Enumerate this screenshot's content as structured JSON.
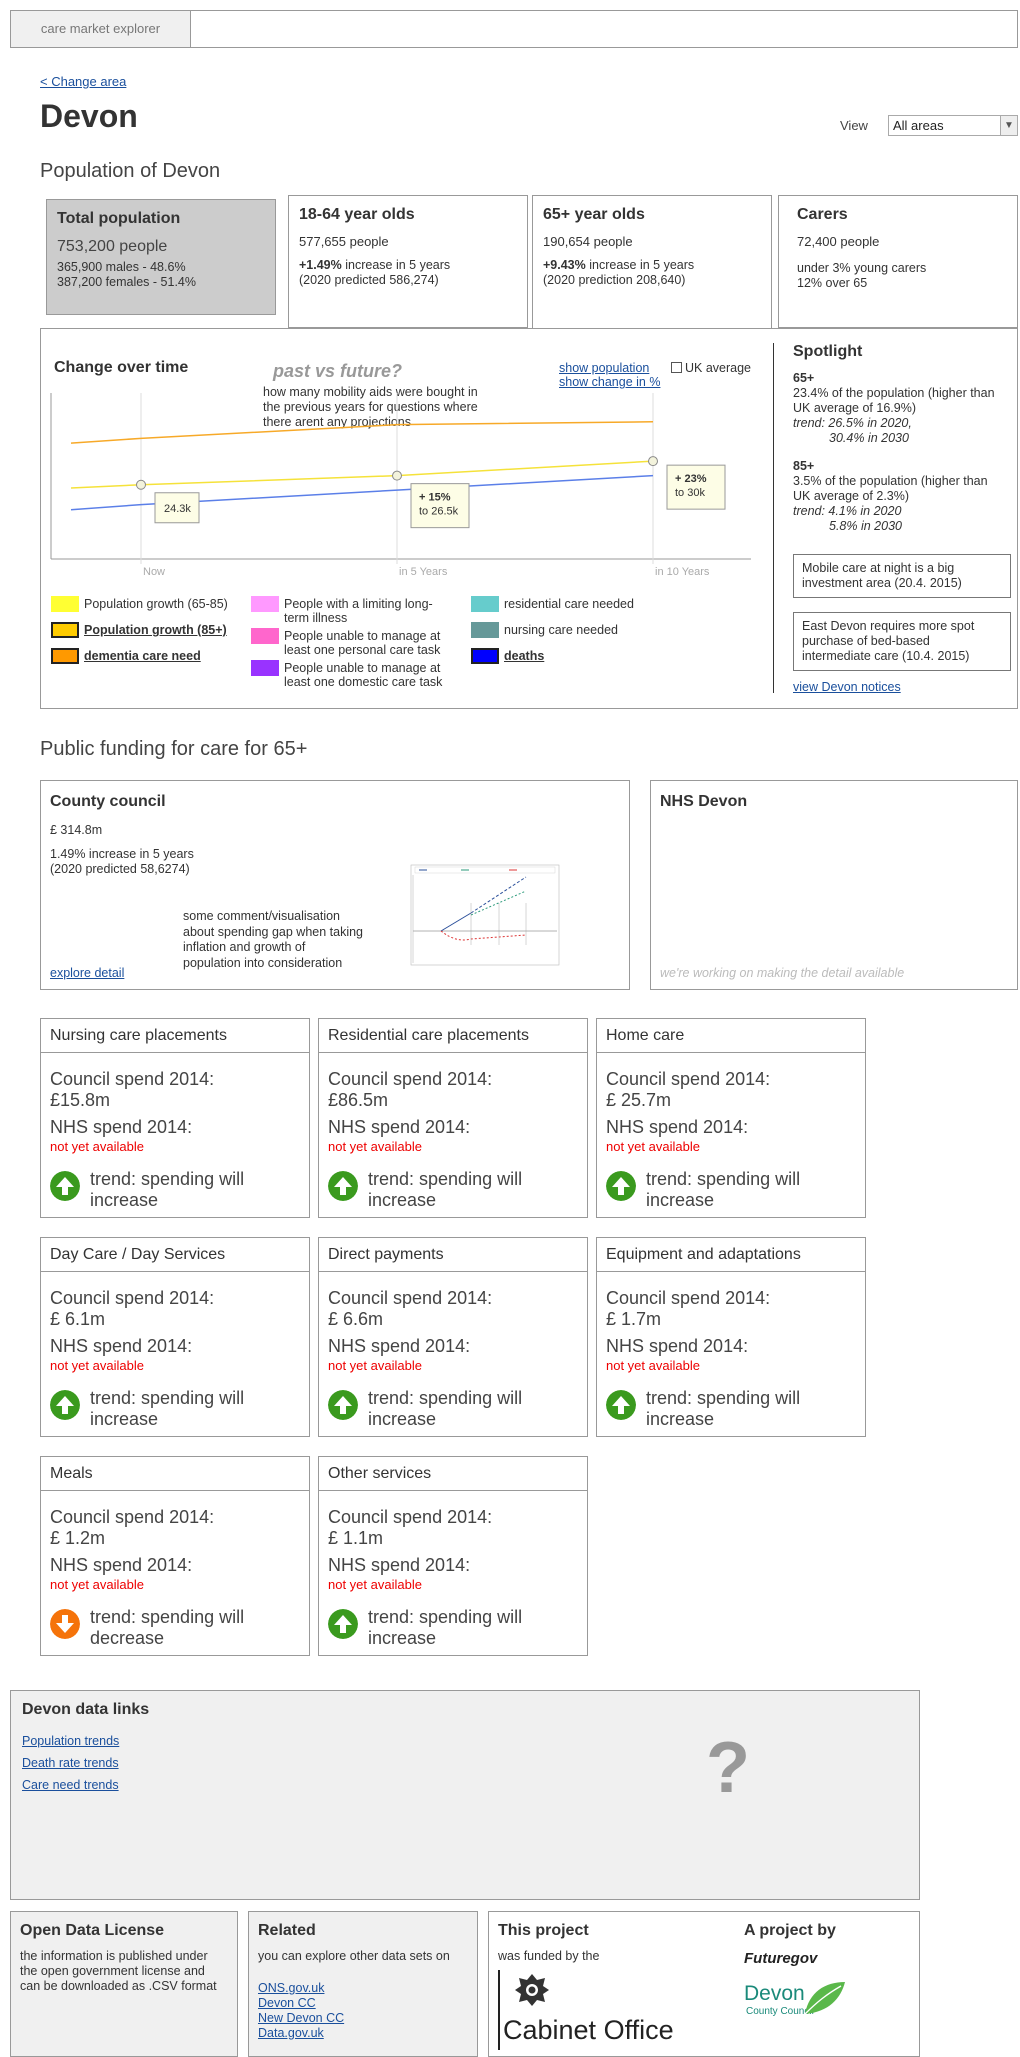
{
  "app": {
    "name": "care market explorer"
  },
  "header": {
    "change_area": "< Change area",
    "title": "Devon",
    "view_label": "View",
    "view_selected": "All areas"
  },
  "population": {
    "section_title": "Population of Devon",
    "total": {
      "title": "Total population",
      "people": "753,200 people",
      "males": "365,900 males - 48.6%",
      "females": "387,200 females  - 51.4%"
    },
    "age1864": {
      "title": "18-64 year olds",
      "people": "577,655 people",
      "increase_bold": "+1.49%",
      "increase_rest": " increase in 5 years",
      "predicted": "(2020 predicted 586,274)"
    },
    "age65": {
      "title": "65+ year olds",
      "people": "190,654 people",
      "increase_bold": "+9.43%",
      "increase_rest": " increase in 5 years",
      "predicted": "(2020 prediction 208,640)"
    },
    "carers": {
      "title": "Carers",
      "people": "72,400 people",
      "young": "under 3% young carers",
      "over65": "12% over 65"
    }
  },
  "chart_panel": {
    "title": "Change over time",
    "handwrite": "past vs future?",
    "note": "how many mobility aids were bought in the previous years for questions where there arent any projections",
    "show_population": "show population",
    "show_change": "show change in %",
    "uk_average": "UK average"
  },
  "chart_data": {
    "type": "line",
    "categories": [
      "Now",
      "in 5 Years",
      "in 10 Years"
    ],
    "series": [
      {
        "name": "Population growth (65-85)",
        "color": "#f5e23a",
        "values": [
          24.3,
          26.5,
          30
        ]
      },
      {
        "name": "Population growth (85+)",
        "color": "#f7a928",
        "values": [
          35.5,
          38.8,
          39.5
        ]
      },
      {
        "name": "deaths",
        "color": "#5b7fe8",
        "values": [
          19.5,
          23.0,
          26.5
        ]
      }
    ],
    "annotations": [
      {
        "category": "Now",
        "label": "24.3k"
      },
      {
        "category": "in 5 Years",
        "label_bold": "+ 15%",
        "label": "to 26.5k"
      },
      {
        "category": "in 10 Years",
        "label_bold": "+ 23%",
        "label": "to 30k"
      }
    ],
    "ylim": [
      10,
      45
    ]
  },
  "legend": [
    {
      "label": "Population growth (65-85)",
      "color": "#ffff33",
      "style": "plain"
    },
    {
      "label": "Population growth (85+)",
      "color": "#ffcc00",
      "style": "bold"
    },
    {
      "label": "dementia care need",
      "color": "#ff9900",
      "style": "bold"
    },
    {
      "label": "People with a limiting long-term illness",
      "color": "#ff99ff",
      "style": "plain"
    },
    {
      "label": "People unable to manage at least one personal care task",
      "color": "#ff66cc",
      "style": "plain"
    },
    {
      "label": "People unable to manage at least one domestic care task",
      "color": "#9933ff",
      "style": "plain"
    },
    {
      "label": "residential care needed",
      "color": "#66cccc",
      "style": "plain"
    },
    {
      "label": "nursing care needed",
      "color": "#669999",
      "style": "plain"
    },
    {
      "label": "deaths",
      "color": "#0000ff",
      "style": "bold"
    }
  ],
  "spotlight": {
    "title": "Spotlight",
    "b65": {
      "head": "65+",
      "text": "23.4% of the population (higher than UK average of 16.9%)",
      "trend1": "trend: 26.5% in 2020,",
      "trend2": "30.4% in 2030"
    },
    "b85": {
      "head": "85+",
      "text": "3.5% of the population (higher than UK average of 2.3%)",
      "trend1": "trend: 4.1% in 2020",
      "trend2": "5.8% in 2030"
    },
    "notice1": "Mobile care at night is a big investment area (20.4. 2015)",
    "notice2": "East Devon requires more spot purchase of bed-based intermediate care (10.4. 2015)",
    "view_notices": "view Devon notices"
  },
  "funding": {
    "section_title": "Public funding for care for 65+",
    "county": {
      "title": "County council",
      "amount": "£ 314.8m",
      "increase": "1.49% increase in 5 years",
      "predicted": "(2020 predicted 58,6274)",
      "comment": "some comment/visualisation about spending gap when taking inflation and growth of population into consideration",
      "explore": "explore detail"
    },
    "nhs": {
      "title": "NHS Devon",
      "working": "we're working on making the detail available"
    }
  },
  "spend_cards": [
    {
      "title": "Nursing care placements",
      "council_label": "Council spend 2014:",
      "council_value": "£15.8m",
      "nhs_label": "NHS spend 2014:",
      "nhs_value": "not yet available",
      "trend": "trend: spending will increase",
      "direction": "up"
    },
    {
      "title": "Residential care placements",
      "council_label": "Council spend 2014:",
      "council_value": "£86.5m",
      "nhs_label": "NHS spend 2014:",
      "nhs_value": "not yet available",
      "trend": "trend: spending will increase",
      "direction": "up"
    },
    {
      "title": "Home care",
      "council_label": "Council spend 2014:",
      "council_value": "£ 25.7m",
      "nhs_label": "NHS spend 2014:",
      "nhs_value": "not yet available",
      "trend": "trend: spending will increase",
      "direction": "up"
    },
    {
      "title": "Day Care / Day Services",
      "council_label": "Council spend 2014:",
      "council_value": "£ 6.1m",
      "nhs_label": "NHS spend 2014:",
      "nhs_value": "not yet available",
      "trend": "trend: spending will increase",
      "direction": "up"
    },
    {
      "title": "Direct payments",
      "council_label": "Council spend 2014:",
      "council_value": "£ 6.6m",
      "nhs_label": "NHS spend 2014:",
      "nhs_value": "not yet available",
      "trend": "trend: spending will increase",
      "direction": "up"
    },
    {
      "title": "Equipment and adaptations",
      "council_label": "Council spend 2014:",
      "council_value": "£ 1.7m",
      "nhs_label": "NHS spend 2014:",
      "nhs_value": "not yet available",
      "trend": "trend: spending will increase",
      "direction": "up"
    },
    {
      "title": "Meals",
      "council_label": "Council spend 2014:",
      "council_value": "£ 1.2m",
      "nhs_label": "NHS spend 2014:",
      "nhs_value": "not yet available",
      "trend": "trend: spending will decrease",
      "direction": "down"
    },
    {
      "title": "Other services",
      "council_label": "Council spend 2014:",
      "council_value": "£ 1.1m",
      "nhs_label": "NHS spend 2014:",
      "nhs_value": "not yet available",
      "trend": "trend: spending will increase",
      "direction": "up"
    }
  ],
  "colors": {
    "trend_up": "#3a9a1e",
    "trend_down": "#f5730a",
    "link": "#1a4f9c",
    "unavailable": "#ee0000"
  },
  "data_links": {
    "title": "Devon data links",
    "links": [
      "Population trends",
      "Death rate trends",
      "Care need trends"
    ],
    "placeholder": "?"
  },
  "footer": {
    "license": {
      "title": "Open Data License",
      "text": "the information is published under the open government license and can be downloaded as .CSV format"
    },
    "related": {
      "title": "Related",
      "text": "you can explore other data sets on",
      "links": [
        "ONS.gov.uk",
        "Devon CC",
        "New Devon CC",
        "Data.gov.uk"
      ]
    },
    "project": {
      "title": "This project",
      "funded": "was funded by the",
      "funder": "Cabinet Office",
      "by_title": "A project by",
      "futuregov": "Futuregov",
      "devon_cc_1": "Devon",
      "devon_cc_2": "County Council"
    }
  }
}
